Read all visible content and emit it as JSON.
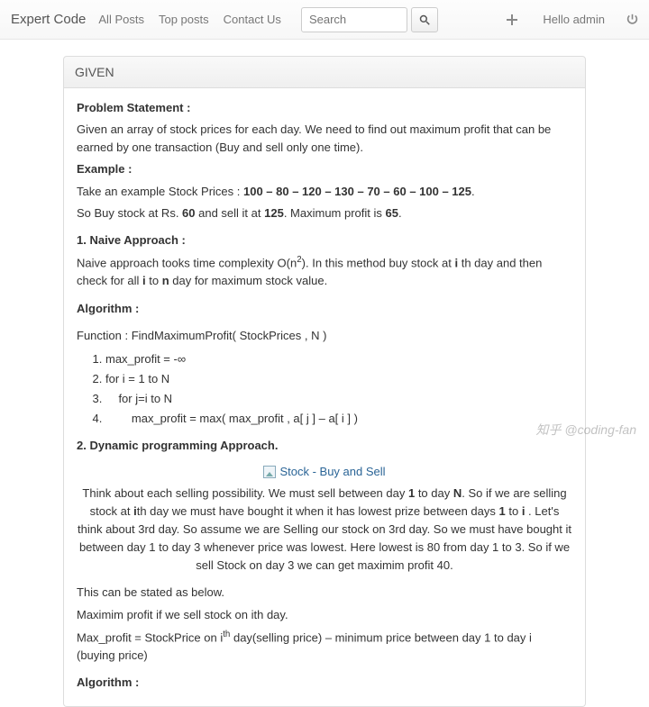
{
  "nav": {
    "brand": "Expert Code",
    "links": [
      "All Posts",
      "Top posts",
      "Contact Us"
    ],
    "search_placeholder": "Search",
    "hello": "Hello admin"
  },
  "panel": {
    "title": "GIVEN"
  },
  "problem": {
    "h_statement": "Problem Statement :",
    "statement": "Given an array of stock prices for each day. We need to find out maximum profit that can be earned by one transaction (Buy and sell only one time).",
    "h_example": "Example :",
    "example_prefix": "Take an example Stock Prices : ",
    "example_values": "100 –  80 – 120 – 130 – 70  – 60 –  100  –  125",
    "example_dot": ".",
    "buy_prefix": "So Buy stock at Rs. ",
    "buy_val": "60",
    "buy_mid": " and sell it at ",
    "sell_val": "125",
    "buy_mid2": ". Maximum profit is ",
    "profit_val": "65",
    "buy_end": "."
  },
  "naive": {
    "h": "1. Naive Approach :",
    "p1a": "Naive approach tooks time complexity O(n",
    "p1b": "). In this method buy stock at ",
    "p1c": " th day and then check for all ",
    "p1d": " to ",
    "p1e": " day for maximum stock value.",
    "i": "i",
    "n": "n",
    "sup": "2",
    "h_algo": "Algorithm :",
    "func": "Function : FindMaximumProfit( StockPrices , N )",
    "steps": [
      "max_profit = -∞",
      "for i = 1 to N",
      "    for j=i to N",
      "        max_profit = max( max_profit , a[ j ]  – a[ i ] )"
    ]
  },
  "dp": {
    "h": "2. Dynamic programming Approach.",
    "img_alt": "Stock - Buy and Sell",
    "para_a": "Think about each selling possibility. We must sell between day ",
    "one": "1",
    "para_b": " to day ",
    "N": "N",
    "para_c": ". So if we are selling stock at ",
    "i": "i",
    "para_d": "th day we must have bought it when it has lowest prize between days ",
    "para_e": " to ",
    "para_f": " . Let's think about 3rd day. So assume we are Selling our stock on 3rd day. So we must have bought it between day 1 to day 3 whenever price was lowest. Here lowest is 80 from day 1 to 3. So if we sell Stock on day 3 we can get maximim profit 40.",
    "below": "This can be stated as below.",
    "max1": "Maximim profit if we sell stock on ith day.",
    "max2a": "Max_profit = StockPrice on i",
    "th": "th",
    "max2b": " day(selling price) –  minimum price between day 1 to day i (buying price)",
    "h_algo": "Algorithm :"
  },
  "watermark": "知乎 @coding-fan"
}
